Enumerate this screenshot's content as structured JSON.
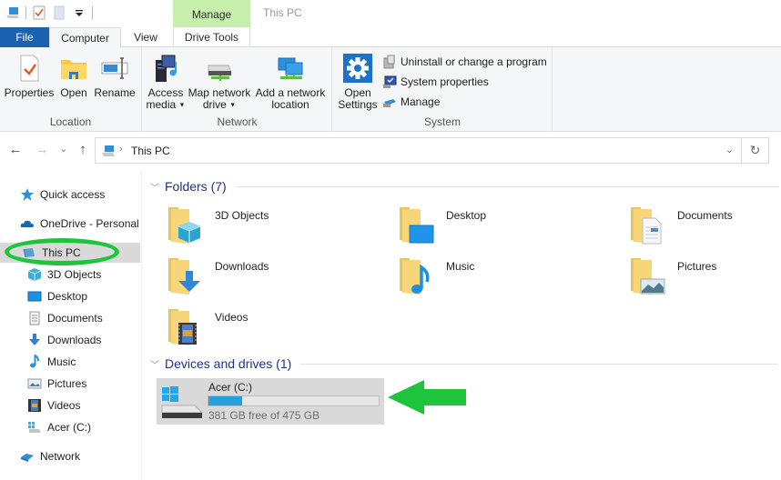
{
  "window": {
    "title": "This PC",
    "context_tab_group": "Manage"
  },
  "quick_access_toolbar": {
    "items": [
      "this-pc-icon",
      "properties-icon",
      "new-folder-icon",
      "customize-dropdown-icon"
    ]
  },
  "tabs": [
    {
      "label": "File",
      "active": false
    },
    {
      "label": "Computer",
      "active": true
    },
    {
      "label": "View",
      "active": false
    },
    {
      "label": "Drive Tools",
      "active": false
    }
  ],
  "ribbon": {
    "groups": [
      {
        "label": "Location",
        "buttons": [
          {
            "label": "Properties",
            "icon": "properties-icon"
          },
          {
            "label": "Open",
            "icon": "open-folder-icon"
          },
          {
            "label": "Rename",
            "icon": "rename-icon"
          }
        ]
      },
      {
        "label": "Network",
        "buttons": [
          {
            "label_line1": "Access",
            "label_line2": "media",
            "icon": "access-media-icon",
            "dropdown": true
          },
          {
            "label_line1": "Map network",
            "label_line2": "drive",
            "icon": "map-drive-icon",
            "dropdown": true
          },
          {
            "label_line1": "Add a network",
            "label_line2": "location",
            "icon": "network-location-icon"
          }
        ]
      },
      {
        "label": "System",
        "buttons": [
          {
            "label_line1": "Open",
            "label_line2": "Settings",
            "icon": "settings-gear-icon"
          }
        ],
        "small_buttons": [
          {
            "label": "Uninstall or change a program",
            "icon": "uninstall-icon"
          },
          {
            "label": "System properties",
            "icon": "system-properties-icon"
          },
          {
            "label": "Manage",
            "icon": "manage-icon"
          }
        ]
      }
    ]
  },
  "address_bar": {
    "path": "This PC",
    "back_glyph": "←",
    "forward_glyph": "→",
    "recent_glyph": "⌄",
    "up_glyph": "↑",
    "separator_glyph": "›",
    "dropdown_glyph": "⌄",
    "refresh_glyph": "↻"
  },
  "sidebar": {
    "items": [
      {
        "label": "Quick access",
        "icon": "star-icon"
      },
      {
        "label": "OneDrive - Personal",
        "icon": "cloud-icon"
      },
      {
        "label": "This PC",
        "icon": "this-pc-icon",
        "selected": true
      },
      {
        "label": "3D Objects",
        "icon": "3d-objects-icon"
      },
      {
        "label": "Desktop",
        "icon": "desktop-icon"
      },
      {
        "label": "Documents",
        "icon": "documents-icon"
      },
      {
        "label": "Downloads",
        "icon": "downloads-icon"
      },
      {
        "label": "Music",
        "icon": "music-icon"
      },
      {
        "label": "Pictures",
        "icon": "pictures-icon"
      },
      {
        "label": "Videos",
        "icon": "videos-icon"
      },
      {
        "label": "Acer (C:)",
        "icon": "drive-icon"
      },
      {
        "label": "Network",
        "icon": "network-icon"
      }
    ]
  },
  "content": {
    "folders_header": "Folders (7)",
    "folders": [
      {
        "name": "3D Objects",
        "overlay": "3d-cube"
      },
      {
        "name": "Desktop",
        "overlay": "desktop"
      },
      {
        "name": "Documents",
        "overlay": "document"
      },
      {
        "name": "Downloads",
        "overlay": "download-arrow"
      },
      {
        "name": "Music",
        "overlay": "music-note"
      },
      {
        "name": "Pictures",
        "overlay": "picture"
      },
      {
        "name": "Videos",
        "overlay": "film"
      }
    ],
    "devices_header": "Devices and drives (1)",
    "drives": [
      {
        "name": "Acer (C:)",
        "free_text": "381 GB free of 475 GB",
        "free_gb": 381,
        "total_gb": 475,
        "used_fraction": 0.198
      }
    ]
  },
  "annotations": {
    "highlight_color": "#1ec43c",
    "highlight_target": "This PC",
    "arrow_target": "Acer (C:)"
  },
  "colors": {
    "file_tab": "#1a62b1",
    "manage_context": "#c6efac",
    "section_header": "#1e3287",
    "drive_bar_fill": "#26a0da",
    "selected_bg": "#d9d9d9"
  }
}
